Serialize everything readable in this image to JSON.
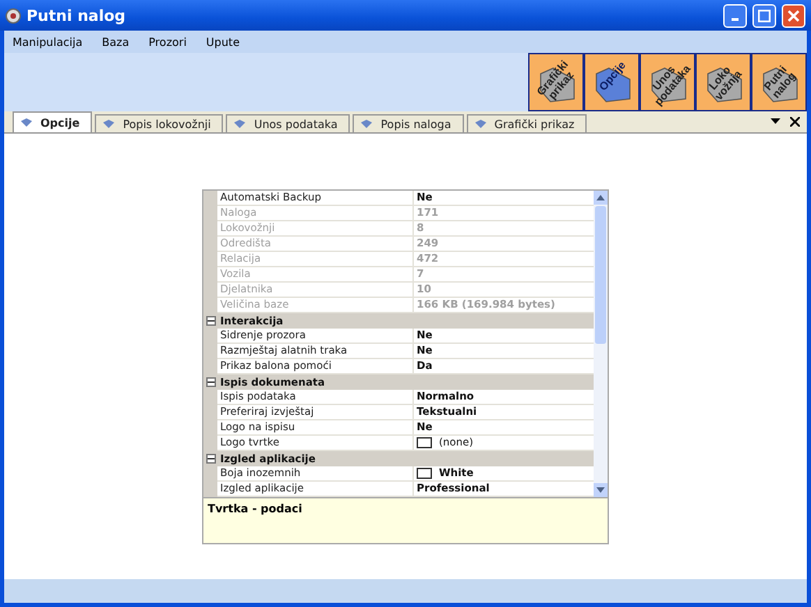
{
  "window": {
    "title": "Putni nalog"
  },
  "menu": [
    "Manipulacija",
    "Baza",
    "Prozori",
    "Upute"
  ],
  "toolbar": [
    {
      "label": "Grafički prikaz",
      "selected": false
    },
    {
      "label": "Opcije",
      "selected": true
    },
    {
      "label": "Unos podataka",
      "selected": false
    },
    {
      "label": "Loko vožnja",
      "selected": false
    },
    {
      "label": "Putni nalog",
      "selected": false
    }
  ],
  "tabs": [
    {
      "label": "Opcije",
      "selected": true
    },
    {
      "label": "Popis lokovožnji",
      "selected": false
    },
    {
      "label": "Unos podataka",
      "selected": false
    },
    {
      "label": "Popis naloga",
      "selected": false
    },
    {
      "label": "Grafički prikaz",
      "selected": false
    }
  ],
  "properties": [
    {
      "kind": "property",
      "name": "Automatski Backup",
      "value": "Ne",
      "disabled": false
    },
    {
      "kind": "property",
      "name": "Naloga",
      "value": "171",
      "disabled": true
    },
    {
      "kind": "property",
      "name": "Lokovožnji",
      "value": "8",
      "disabled": true
    },
    {
      "kind": "property",
      "name": "Odredišta",
      "value": "249",
      "disabled": true
    },
    {
      "kind": "property",
      "name": "Relacija",
      "value": "472",
      "disabled": true
    },
    {
      "kind": "property",
      "name": "Vozila",
      "value": "7",
      "disabled": true
    },
    {
      "kind": "property",
      "name": "Djelatnika",
      "value": "10",
      "disabled": true
    },
    {
      "kind": "property",
      "name": "Veličina baze",
      "value": "166 KB (169.984 bytes)",
      "disabled": true
    },
    {
      "kind": "category",
      "name": "Interakcija",
      "expanded": true
    },
    {
      "kind": "property",
      "name": "Sidrenje prozora",
      "value": "Ne",
      "disabled": false
    },
    {
      "kind": "property",
      "name": "Razmještaj alatnih traka",
      "value": "Ne",
      "disabled": false
    },
    {
      "kind": "property",
      "name": "Prikaz balona pomoći",
      "value": "Da",
      "disabled": false
    },
    {
      "kind": "category",
      "name": "Ispis dokumenata",
      "expanded": true
    },
    {
      "kind": "property",
      "name": "Ispis podataka",
      "value": "Normalno",
      "disabled": false
    },
    {
      "kind": "property",
      "name": "Preferiraj izvještaj",
      "value": "Tekstualni",
      "disabled": false
    },
    {
      "kind": "property",
      "name": "Logo na ispisu",
      "value": "Ne",
      "disabled": false
    },
    {
      "kind": "swatch",
      "name": "Logo tvrtke",
      "value": "(none)",
      "bold": false
    },
    {
      "kind": "category",
      "name": "Izgled aplikacije",
      "expanded": true
    },
    {
      "kind": "swatch",
      "name": "Boja inozemnih",
      "value": "White",
      "bold": true
    },
    {
      "kind": "property",
      "name": "Izgled aplikacije",
      "value": "Professional",
      "disabled": false
    }
  ],
  "description": {
    "title": "Tvrtka - podaci"
  }
}
